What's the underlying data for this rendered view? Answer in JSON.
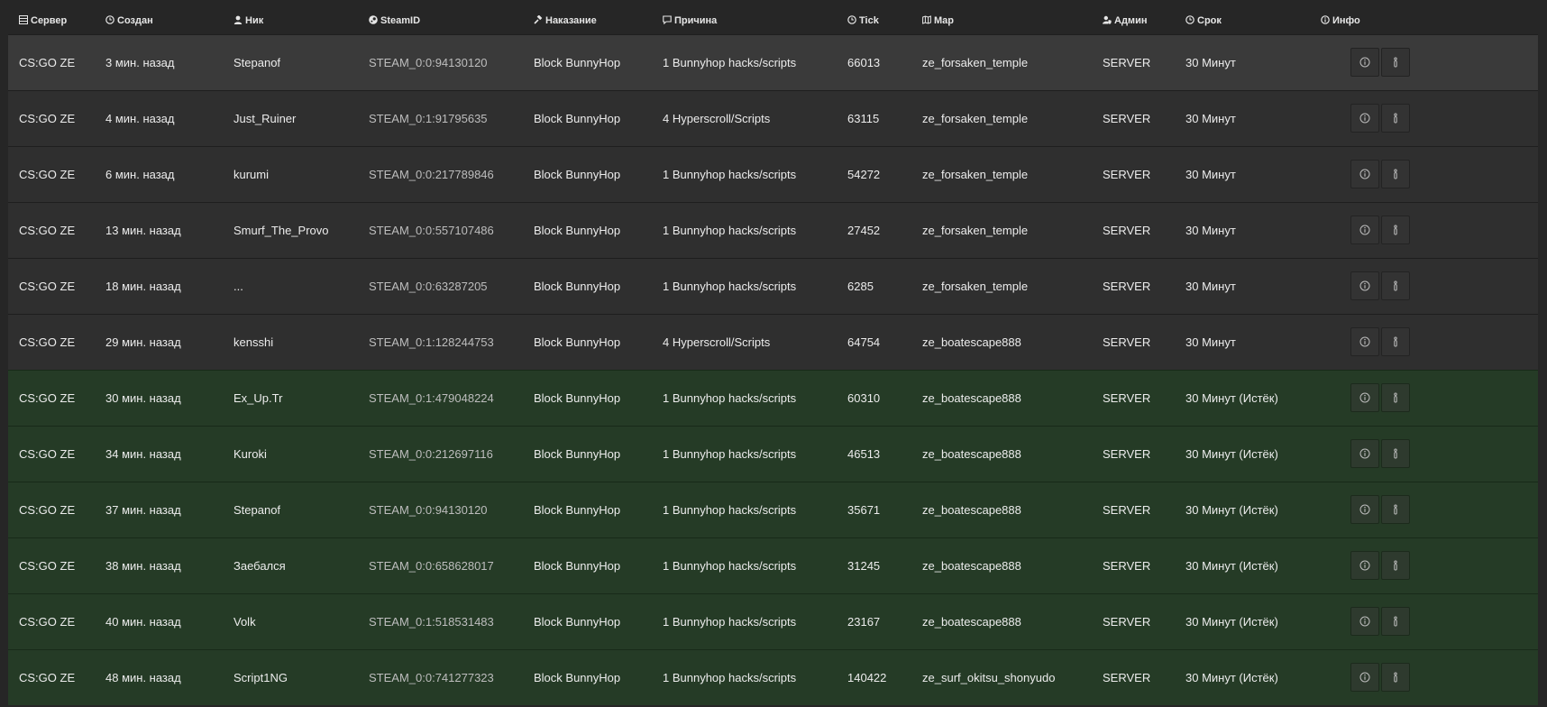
{
  "colors": {
    "background": "#262626",
    "row_active": "#2f2f2f",
    "row_first": "#3a3a3a",
    "row_expired": "#253b26"
  },
  "header": {
    "server": "Сервер",
    "created": "Создан",
    "nick": "Ник",
    "steamid": "SteamID",
    "punishment": "Наказание",
    "reason": "Причина",
    "tick": "Tick",
    "map": "Map",
    "admin": "Админ",
    "term": "Срок",
    "info": "Инфо"
  },
  "header_icons": {
    "server": "server-icon",
    "created": "clock-icon",
    "nick": "user-icon",
    "steamid": "steam-icon",
    "punishment": "gavel-icon",
    "reason": "comment-icon",
    "tick": "clock-icon",
    "map": "map-icon",
    "admin": "user-shield-icon",
    "term": "clock-icon",
    "info": "info-circle-icon"
  },
  "row_buttons": [
    "info-icon",
    "details-icon"
  ],
  "rows": [
    {
      "server": "CS:GO ZE",
      "created": "3 мин. назад",
      "nick": "Stepanof",
      "steamid": "STEAM_0:0:94130120",
      "punishment": "Block BunnyHop",
      "reason": "1 Bunnyhop hacks/scripts",
      "tick": "66013",
      "map": "ze_forsaken_temple",
      "admin": "SERVER",
      "term": "30 Минут",
      "status": "first"
    },
    {
      "server": "CS:GO ZE",
      "created": "4 мин. назад",
      "nick": "Just_Ruiner",
      "steamid": "STEAM_0:1:91795635",
      "punishment": "Block BunnyHop",
      "reason": "4 Hyperscroll/Scripts",
      "tick": "63115",
      "map": "ze_forsaken_temple",
      "admin": "SERVER",
      "term": "30 Минут",
      "status": "active"
    },
    {
      "server": "CS:GO ZE",
      "created": "6 мин. назад",
      "nick": "kurumi",
      "steamid": "STEAM_0:0:217789846",
      "punishment": "Block BunnyHop",
      "reason": "1 Bunnyhop hacks/scripts",
      "tick": "54272",
      "map": "ze_forsaken_temple",
      "admin": "SERVER",
      "term": "30 Минут",
      "status": "active"
    },
    {
      "server": "CS:GO ZE",
      "created": "13 мин. назад",
      "nick": "Smurf_The_Provo",
      "steamid": "STEAM_0:0:557107486",
      "punishment": "Block BunnyHop",
      "reason": "1 Bunnyhop hacks/scripts",
      "tick": "27452",
      "map": "ze_forsaken_temple",
      "admin": "SERVER",
      "term": "30 Минут",
      "status": "active"
    },
    {
      "server": "CS:GO ZE",
      "created": "18 мин. назад",
      "nick": "...",
      "steamid": "STEAM_0:0:63287205",
      "punishment": "Block BunnyHop",
      "reason": "1 Bunnyhop hacks/scripts",
      "tick": "6285",
      "map": "ze_forsaken_temple",
      "admin": "SERVER",
      "term": "30 Минут",
      "status": "active"
    },
    {
      "server": "CS:GO ZE",
      "created": "29 мин. назад",
      "nick": "kensshi",
      "steamid": "STEAM_0:1:128244753",
      "punishment": "Block BunnyHop",
      "reason": "4 Hyperscroll/Scripts",
      "tick": "64754",
      "map": "ze_boatescape888",
      "admin": "SERVER",
      "term": "30 Минут",
      "status": "active"
    },
    {
      "server": "CS:GO ZE",
      "created": "30 мин. назад",
      "nick": "Ex_Up.Tr",
      "steamid": "STEAM_0:1:479048224",
      "punishment": "Block BunnyHop",
      "reason": "1 Bunnyhop hacks/scripts",
      "tick": "60310",
      "map": "ze_boatescape888",
      "admin": "SERVER",
      "term": "30 Минут (Истёк)",
      "status": "expired"
    },
    {
      "server": "CS:GO ZE",
      "created": "34 мин. назад",
      "nick": "Kuroki",
      "steamid": "STEAM_0:0:212697116",
      "punishment": "Block BunnyHop",
      "reason": "1 Bunnyhop hacks/scripts",
      "tick": "46513",
      "map": "ze_boatescape888",
      "admin": "SERVER",
      "term": "30 Минут (Истёк)",
      "status": "expired"
    },
    {
      "server": "CS:GO ZE",
      "created": "37 мин. назад",
      "nick": "Stepanof",
      "steamid": "STEAM_0:0:94130120",
      "punishment": "Block BunnyHop",
      "reason": "1 Bunnyhop hacks/scripts",
      "tick": "35671",
      "map": "ze_boatescape888",
      "admin": "SERVER",
      "term": "30 Минут (Истёк)",
      "status": "expired"
    },
    {
      "server": "CS:GO ZE",
      "created": "38 мин. назад",
      "nick": "Заебался",
      "steamid": "STEAM_0:0:658628017",
      "punishment": "Block BunnyHop",
      "reason": "1 Bunnyhop hacks/scripts",
      "tick": "31245",
      "map": "ze_boatescape888",
      "admin": "SERVER",
      "term": "30 Минут (Истёк)",
      "status": "expired"
    },
    {
      "server": "CS:GO ZE",
      "created": "40 мин. назад",
      "nick": "Volk",
      "steamid": "STEAM_0:1:518531483",
      "punishment": "Block BunnyHop",
      "reason": "1 Bunnyhop hacks/scripts",
      "tick": "23167",
      "map": "ze_boatescape888",
      "admin": "SERVER",
      "term": "30 Минут (Истёк)",
      "status": "expired"
    },
    {
      "server": "CS:GO ZE",
      "created": "48 мин. назад",
      "nick": "Script1NG",
      "steamid": "STEAM_0:0:741277323",
      "punishment": "Block BunnyHop",
      "reason": "1 Bunnyhop hacks/scripts",
      "tick": "140422",
      "map": "ze_surf_okitsu_shonyudo",
      "admin": "SERVER",
      "term": "30 Минут (Истёк)",
      "status": "expired"
    }
  ]
}
